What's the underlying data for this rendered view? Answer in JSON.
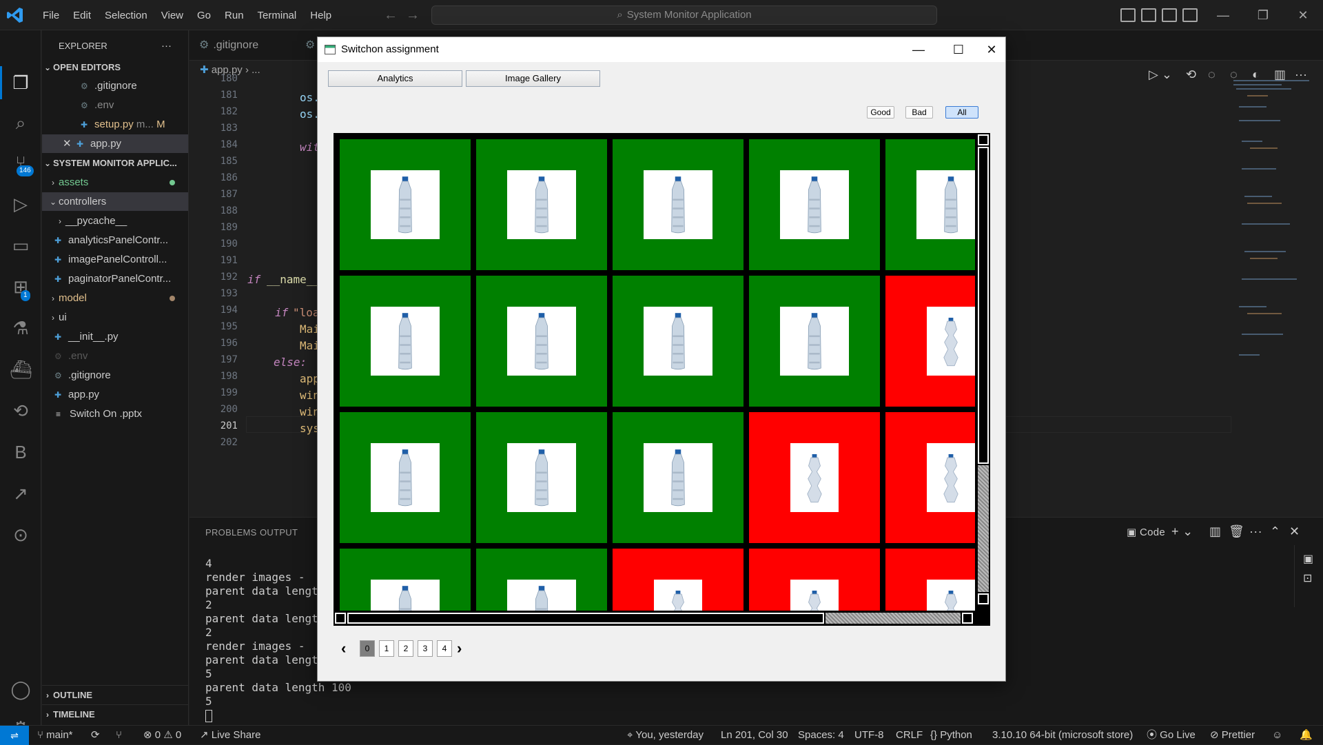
{
  "titlebar": {
    "menu": [
      "File",
      "Edit",
      "Selection",
      "View",
      "Go",
      "Run",
      "Terminal",
      "Help"
    ],
    "search": "System Monitor Application"
  },
  "activity": {
    "source_control_badge": "146",
    "extensions_badge": "1"
  },
  "sidebar": {
    "explorer_label": "EXPLORER",
    "open_editors_label": "OPEN EDITORS",
    "open_editors": [
      {
        "name": ".gitignore"
      },
      {
        "name": ".env"
      },
      {
        "name": "setup.py",
        "suffix": "m...",
        "status": "M"
      },
      {
        "name": "app.py"
      }
    ],
    "project_label": "SYSTEM MONITOR APPLIC...",
    "tree": [
      {
        "name": "assets"
      },
      {
        "name": "controllers"
      },
      {
        "name": "__pycache__"
      },
      {
        "name": "analyticsPanelContr..."
      },
      {
        "name": "imagePanelControll..."
      },
      {
        "name": "paginatorPanelContr..."
      },
      {
        "name": "model"
      },
      {
        "name": "ui"
      },
      {
        "name": "__init__.py"
      },
      {
        "name": ".env"
      },
      {
        "name": ".gitignore"
      },
      {
        "name": "app.py"
      },
      {
        "name": "Switch On .pptx"
      }
    ],
    "outline_label": "OUTLINE",
    "timeline_label": "TIMELINE"
  },
  "editor": {
    "tabs": [
      ".gitignore"
    ],
    "breadcrumb": [
      "app.py",
      "..."
    ],
    "line_numbers": [
      "180",
      "181",
      "182",
      "183",
      "184",
      "185",
      "186",
      "187",
      "188",
      "189",
      "190",
      "191",
      "192",
      "193",
      "194",
      "195",
      "196",
      "197",
      "198",
      "199",
      "200",
      "201",
      "202"
    ],
    "current_line": "201",
    "code_fragments": {
      "l181": "os.",
      "l182": "os.",
      "l184": "wit",
      "l192a": "if",
      "l192b": "__name__",
      "l194a": "if",
      "l194b": "\"loa",
      "l195": "Mai",
      "l196": "Mai",
      "l197": "else:",
      "l198": "app",
      "l199": "win",
      "l200": "win",
      "l201": "sys"
    }
  },
  "panel": {
    "tabs": [
      "PROBLEMS",
      "OUTPUT"
    ],
    "terminal_label": "Code",
    "terminal_lines": [
      "4",
      "render images -  2",
      "parent data length",
      "2",
      "parent data length",
      "2",
      "render images -  2",
      "parent data length",
      "5",
      "parent data length 100",
      "5"
    ]
  },
  "statusbar": {
    "branch": "main*",
    "errors": "0",
    "warnings": "0",
    "live_share": "Live Share",
    "blame": "You, yesterday",
    "cursor": "Ln 201, Col 30",
    "spaces": "Spaces: 4",
    "encoding": "UTF-8",
    "eol": "CRLF",
    "language": "Python",
    "interpreter": "3.10.10 64-bit (microsoft store)",
    "go_live": "Go Live",
    "prettier": "Prettier"
  },
  "app": {
    "title": "Switchon assignment",
    "tabs": [
      "Analytics",
      "Image Gallery"
    ],
    "filters": [
      "Good",
      "Bad",
      "All"
    ],
    "active_filter": "All",
    "gallery_rows": [
      [
        "good",
        "good",
        "good",
        "good",
        "good"
      ],
      [
        "good",
        "good",
        "good",
        "good",
        "bad"
      ],
      [
        "good",
        "good",
        "good",
        "bad",
        "bad"
      ],
      [
        "good",
        "good",
        "bad",
        "bad",
        "bad"
      ]
    ],
    "pages": [
      "0",
      "1",
      "2",
      "3",
      "4"
    ],
    "current_page": "0",
    "colors": {
      "good": "#008000",
      "bad": "#ff0000"
    }
  }
}
